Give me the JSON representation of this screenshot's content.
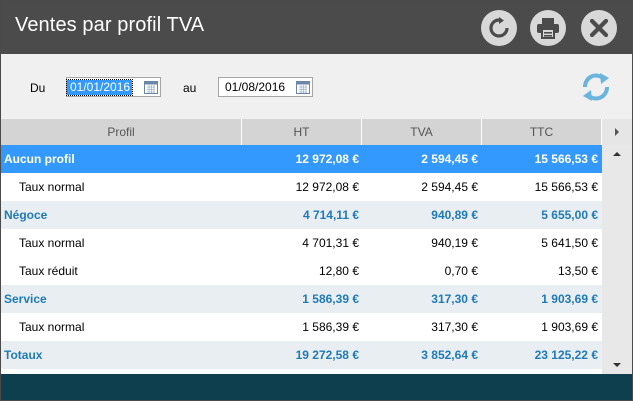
{
  "window": {
    "title": "Ventes par profil TVA",
    "buttons": {
      "reload_icon": "reload-icon",
      "print_icon": "print-icon",
      "close_icon": "close-icon"
    }
  },
  "filters": {
    "from_label": "Du",
    "from_value": "01/01/2016",
    "to_label": "au",
    "to_value": "01/08/2016",
    "refresh_icon": "refresh-icon"
  },
  "table": {
    "columns": [
      "Profil",
      "HT",
      "TVA",
      "TTC"
    ],
    "rows": [
      {
        "kind": "selected",
        "profil": "Aucun profil",
        "ht": "12 972,08 €",
        "tva": "2 594,45 €",
        "ttc": "15 566,53 €"
      },
      {
        "kind": "detail",
        "profil": "Taux normal",
        "ht": "12 972,08 €",
        "tva": "2 594,45 €",
        "ttc": "15 566,53 €"
      },
      {
        "kind": "group",
        "profil": "Négoce",
        "ht": "4 714,11 €",
        "tva": "940,89 €",
        "ttc": "5 655,00 €"
      },
      {
        "kind": "detail",
        "profil": "Taux normal",
        "ht": "4 701,31 €",
        "tva": "940,19 €",
        "ttc": "5 641,50 €"
      },
      {
        "kind": "detail",
        "profil": "Taux réduit",
        "ht": "12,80 €",
        "tva": "0,70 €",
        "ttc": "13,50 €"
      },
      {
        "kind": "group",
        "profil": "Service",
        "ht": "1 586,39 €",
        "tva": "317,30 €",
        "ttc": "1 903,69 €"
      },
      {
        "kind": "detail",
        "profil": "Taux normal",
        "ht": "1 586,39 €",
        "tva": "317,30 €",
        "ttc": "1 903,69 €"
      },
      {
        "kind": "group",
        "profil": "Totaux",
        "ht": "19 272,58 €",
        "tva": "3 852,64 €",
        "ttc": "23 125,22 €"
      }
    ]
  },
  "colors": {
    "titlebar": "#4b4b4b",
    "selected_row": "#3399ff",
    "group_text": "#1f7ab8",
    "footer": "#0e3f4f"
  }
}
